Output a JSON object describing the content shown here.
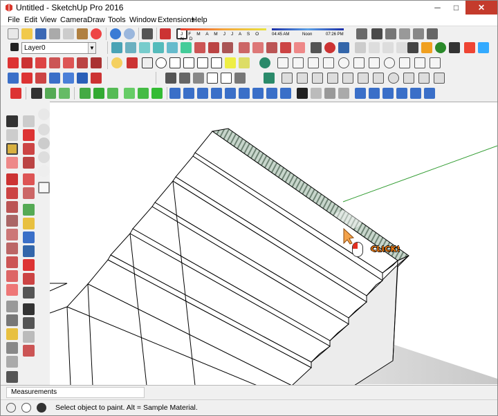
{
  "window": {
    "title": "Untitled - SketchUp Pro 2016",
    "minimize": "─",
    "maximize": "□",
    "close": "✕"
  },
  "menu": [
    "File",
    "Edit",
    "View",
    "Camera",
    "Draw",
    "Tools",
    "Window",
    "Extensions",
    "Help"
  ],
  "toolbar": {
    "layer": "Layer0",
    "months": "J F M A M J J A S O N D",
    "time_start": "04:45 AM",
    "time_mid": "Noon",
    "time_end": "07:26 PM"
  },
  "viewport": {
    "click_label": "CLICK!"
  },
  "measurements": {
    "label": "Measurements"
  },
  "status": {
    "text": "Select object to paint. Alt = Sample Material."
  },
  "colors": {
    "accent_orange": "#f07a10",
    "axis_green": "#2f9b2f",
    "close_red": "#c43b2c"
  }
}
